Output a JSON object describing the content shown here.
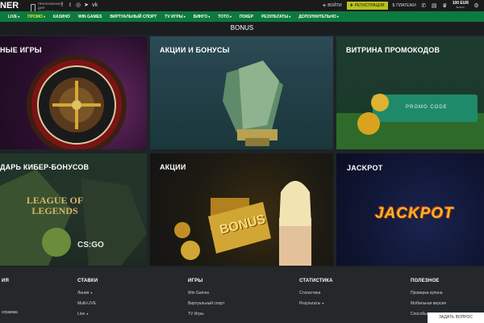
{
  "header": {
    "logo": "NER",
    "app_promo": "ПРИЛОЖЕНИЕ ДЛЯ СМАРТФОНА",
    "socials": [
      {
        "icon": "facebook-icon",
        "glyph": "f"
      },
      {
        "icon": "twitter-icon",
        "glyph": "t"
      },
      {
        "icon": "instagram-icon",
        "glyph": "◎"
      },
      {
        "icon": "telegram-icon",
        "glyph": "➤"
      },
      {
        "icon": "vk-icon",
        "glyph": "vk"
      }
    ],
    "login_label": "ВОЙТИ",
    "register_label": "РЕГИСТРАЦИЯ",
    "payments_label": "ПЛАТЕЖИ",
    "balance_value": "100 EUR",
    "balance_caption": "БОНУС"
  },
  "nav": {
    "items": [
      {
        "label": "LIVE",
        "dropdown": true,
        "active": false
      },
      {
        "label": "ПРОМО",
        "dropdown": true,
        "active": true
      },
      {
        "label": "КАЗИНО",
        "dropdown": false,
        "active": false
      },
      {
        "label": "WIN GAMES",
        "dropdown": false,
        "active": false
      },
      {
        "label": "ВИРТУАЛЬНЫЙ СПОРТ",
        "dropdown": false,
        "active": false
      },
      {
        "label": "TV ИГРЫ",
        "dropdown": true,
        "active": false
      },
      {
        "label": "БИНГО",
        "dropdown": true,
        "active": false
      },
      {
        "label": "ТОТО",
        "dropdown": true,
        "active": false
      },
      {
        "label": "ПОКЕР",
        "dropdown": false,
        "active": false
      },
      {
        "label": "РЕЗУЛЬТАТЫ",
        "dropdown": true,
        "active": false
      },
      {
        "label": "ДОПОЛНИТЕЛЬНО",
        "dropdown": true,
        "active": false
      }
    ]
  },
  "page": {
    "title": "BONUS"
  },
  "tiles": [
    {
      "title": "НЫЕ ИГРЫ"
    },
    {
      "title": "АКЦИИ И БОНУСЫ"
    },
    {
      "title": "ВИТРИНА ПРОМОКОДОВ",
      "promo_code_label": "PROMO CODE"
    },
    {
      "title": "ДАРЬ КИБЕР-БОНУСОВ",
      "game_logo_1": "LEAGUE OF LEGENDS",
      "game_logo_2": "CS:GO"
    },
    {
      "title": "АКЦИИ",
      "badge": "BONUS"
    },
    {
      "title": "JACKPOT",
      "jackpot_label": "JACKPOT"
    }
  ],
  "footer": {
    "columns": [
      {
        "heading": "ИЯ",
        "links": [
          {
            "label": "",
            "dropdown": false
          },
          {
            "label": "",
            "dropdown": false
          },
          {
            "label": "ограмма",
            "dropdown": false
          }
        ]
      },
      {
        "heading": "СТАВКИ",
        "links": [
          {
            "label": "Линия",
            "dropdown": true
          },
          {
            "label": "Multi-LIVE",
            "dropdown": false
          },
          {
            "label": "Live",
            "dropdown": true
          }
        ]
      },
      {
        "heading": "ИГРЫ",
        "links": [
          {
            "label": "Win Games",
            "dropdown": false
          },
          {
            "label": "Виртуальный спорт",
            "dropdown": false
          },
          {
            "label": "TV Игры",
            "dropdown": false
          }
        ]
      },
      {
        "heading": "СТАТИСТИКА",
        "links": [
          {
            "label": "Статистика",
            "dropdown": false
          },
          {
            "label": "Результаты",
            "dropdown": true
          }
        ]
      },
      {
        "heading": "ПОЛЕЗНОЕ",
        "links": [
          {
            "label": "Проверка купона",
            "dropdown": false
          },
          {
            "label": "Мобильная версия",
            "dropdown": false
          },
          {
            "label": "Способы",
            "dropdown": false
          }
        ]
      }
    ]
  },
  "ask_question_label": "ЗАДАТЬ ВОПРОС",
  "colors": {
    "nav_green": "#0c7a3e",
    "active_yellow": "#e5e53c",
    "register_lime": "#b9c11d",
    "footer_bg": "#24282b"
  }
}
